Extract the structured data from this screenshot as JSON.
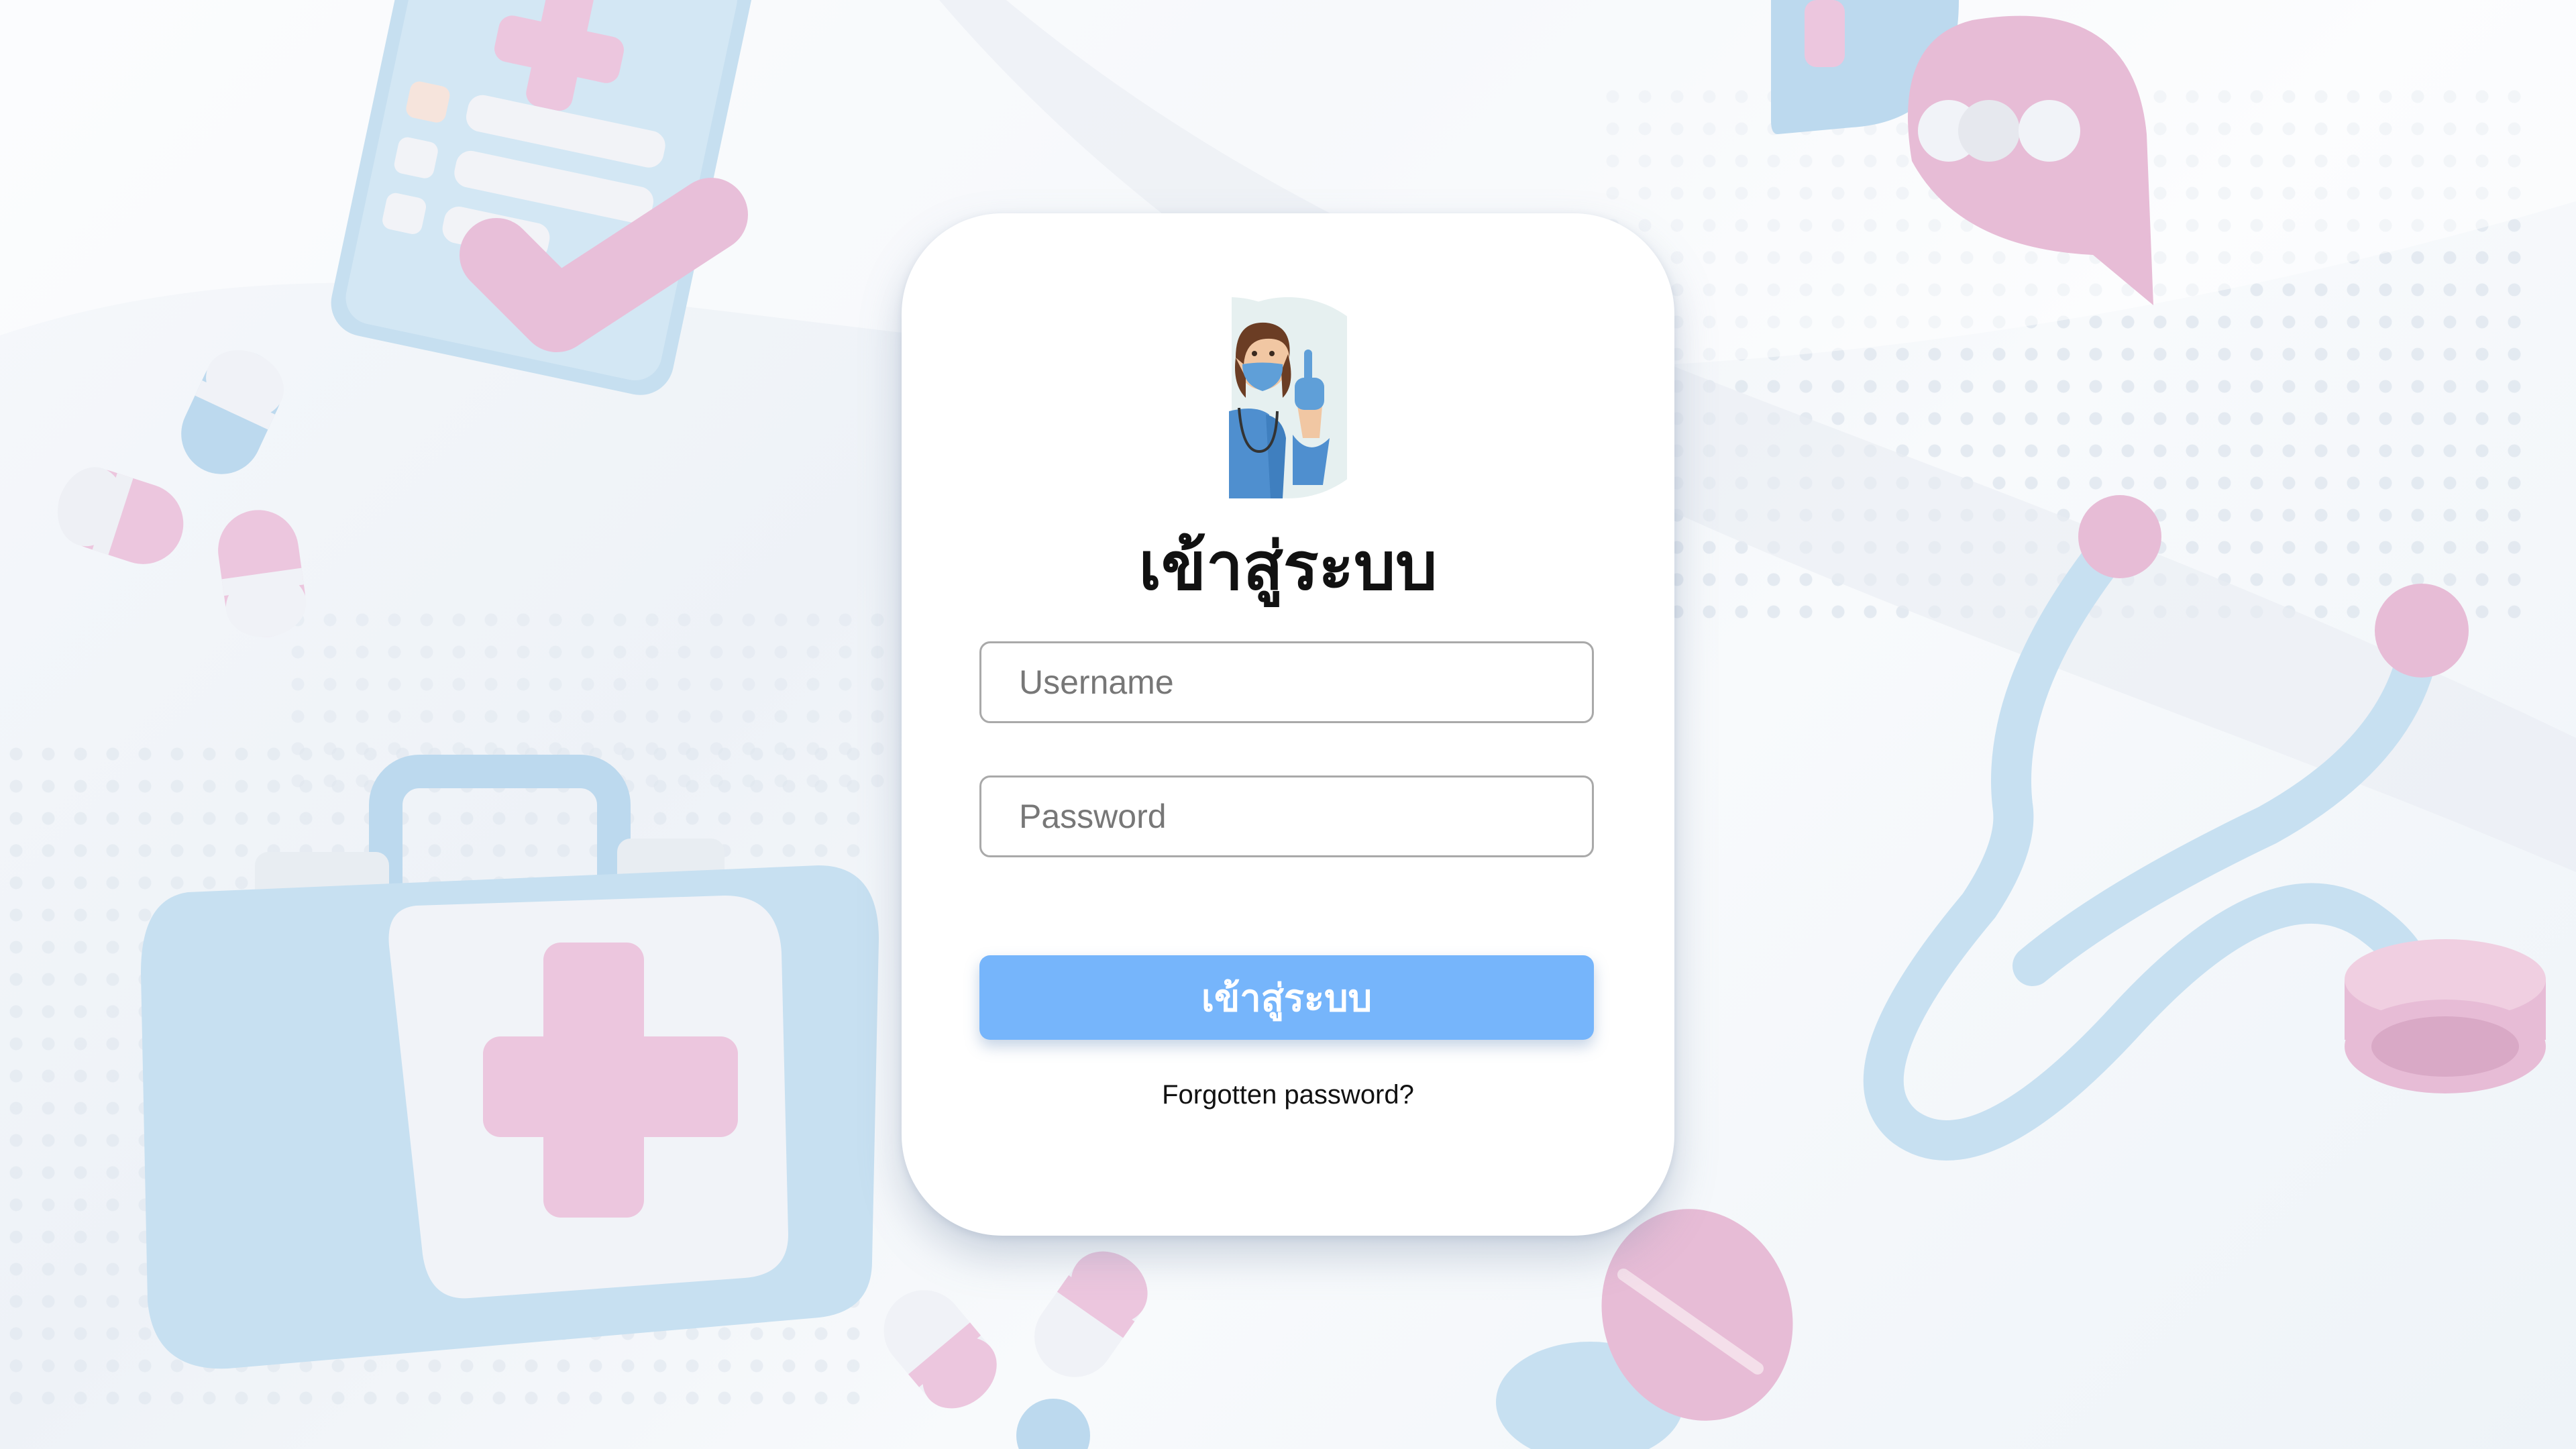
{
  "login": {
    "title": "เข้าสู่ระบบ",
    "username_placeholder": "Username",
    "password_placeholder": "Password",
    "submit_label": "เข้าสู่ระบบ",
    "forgot_label": "Forgotten password?"
  },
  "colors": {
    "button": "#76b5fb",
    "accent_pink": "#e9c4dd",
    "accent_blue": "#bcd9ee",
    "background": "#f3f6fa"
  },
  "icons": [
    "nurse-avatar",
    "medical-clipboard-icon",
    "first-aid-kit-icon",
    "stethoscope-icon",
    "pill-icon",
    "chat-bubble-icon"
  ]
}
